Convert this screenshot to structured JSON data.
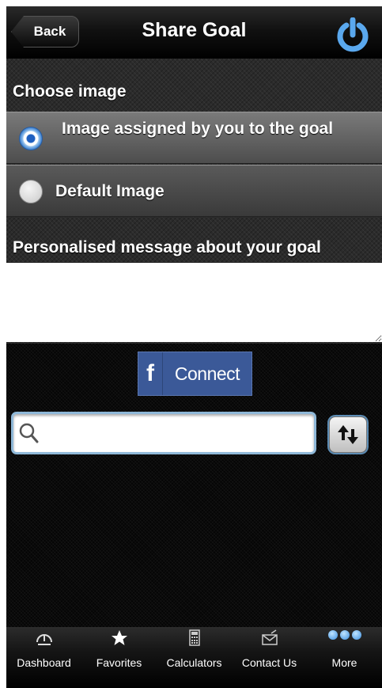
{
  "navbar": {
    "back_label": "Back",
    "title": "Share Goal"
  },
  "choose_image": {
    "heading": "Choose image",
    "options": [
      {
        "label": "Image assigned by you to the goal",
        "selected": true
      },
      {
        "label": "Default Image",
        "selected": false
      }
    ]
  },
  "message": {
    "heading": "Personalised message about your goal",
    "value": ""
  },
  "facebook": {
    "f_glyph": "f",
    "connect_label": "Connect"
  },
  "search": {
    "value": "",
    "placeholder": "",
    "icon": "search-icon"
  },
  "sort": {
    "icon": "sort-arrows-icon"
  },
  "tabbar": {
    "items": [
      {
        "label": "Dashboard",
        "icon": "gauge-icon"
      },
      {
        "label": "Favorites",
        "icon": "star-icon"
      },
      {
        "label": "Calculators",
        "icon": "calculator-icon"
      },
      {
        "label": "Contact Us",
        "icon": "envelope-icon"
      },
      {
        "label": "More",
        "icon": "more-dots-icon"
      }
    ]
  },
  "colors": {
    "facebook_blue": "#3b5998",
    "radio_selected": "#3a7fd0",
    "search_border": "#8fb8d8",
    "power_icon": "#5aa8ee"
  }
}
